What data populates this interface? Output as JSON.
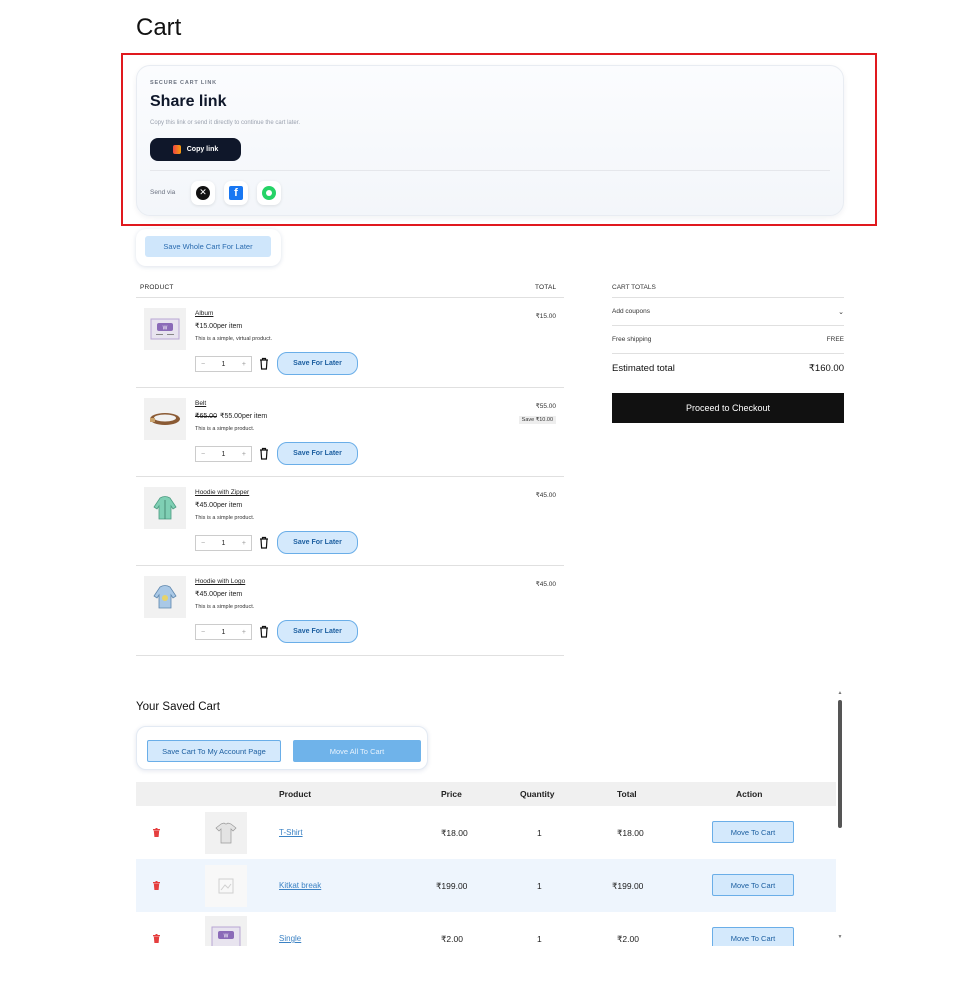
{
  "page": {
    "title": "Cart"
  },
  "share": {
    "eyebrow": "SECURE CART LINK",
    "title": "Share link",
    "description": "Copy this link or send it directly to continue the cart later.",
    "copy_label": "Copy link",
    "send_via": "Send via",
    "channels": [
      "x-icon",
      "facebook-icon",
      "whatsapp-icon"
    ]
  },
  "save_whole_label": "Save Whole Cart For Later",
  "products": {
    "col_product": "PRODUCT",
    "col_total": "TOTAL",
    "items": [
      {
        "name": "Album",
        "old_price": "",
        "price": "₹15.00per item",
        "desc": "This is a simple, virtual product.",
        "qty": "1",
        "total": "₹15.00",
        "badge": "",
        "save_label": "Save For Later"
      },
      {
        "name": "Belt",
        "old_price": "₹65.00",
        "price": "₹55.00per item",
        "desc": "This is a simple product.",
        "qty": "1",
        "total": "₹55.00",
        "badge": "Save ₹10.00",
        "save_label": "Save For Later"
      },
      {
        "name": "Hoodie with Zipper",
        "old_price": "",
        "price": "₹45.00per item",
        "desc": "This is a simple product.",
        "qty": "1",
        "total": "₹45.00",
        "badge": "",
        "save_label": "Save For Later"
      },
      {
        "name": "Hoodie with Logo",
        "old_price": "",
        "price": "₹45.00per item",
        "desc": "This is a simple product.",
        "qty": "1",
        "total": "₹45.00",
        "badge": "",
        "save_label": "Save For Later"
      }
    ]
  },
  "totals": {
    "heading": "CART TOTALS",
    "coupons": "Add coupons",
    "shipping_label": "Free shipping",
    "shipping_value": "FREE",
    "estimated_label": "Estimated total",
    "estimated_value": "₹160.00",
    "checkout_label": "Proceed to Checkout"
  },
  "saved": {
    "title": "Your Saved Cart",
    "account_label": "Save Cart To My Account Page",
    "move_all_label": "Move All To Cart",
    "headers": {
      "product": "Product",
      "price": "Price",
      "quantity": "Quantity",
      "total": "Total",
      "action": "Action"
    },
    "rows": [
      {
        "name": "T-Shirt",
        "price": "₹18.00",
        "qty": "1",
        "total": "₹18.00",
        "action": "Move To Cart"
      },
      {
        "name": "Kitkat break",
        "price": "₹199.00",
        "qty": "1",
        "total": "₹199.00",
        "action": "Move To Cart"
      },
      {
        "name": "Single",
        "price": "₹2.00",
        "qty": "1",
        "total": "₹2.00",
        "action": "Move To Cart"
      }
    ]
  },
  "colors": {
    "accent": "#6aaee8",
    "highlight_border": "#e0191e",
    "delete": "#e53e3e"
  }
}
